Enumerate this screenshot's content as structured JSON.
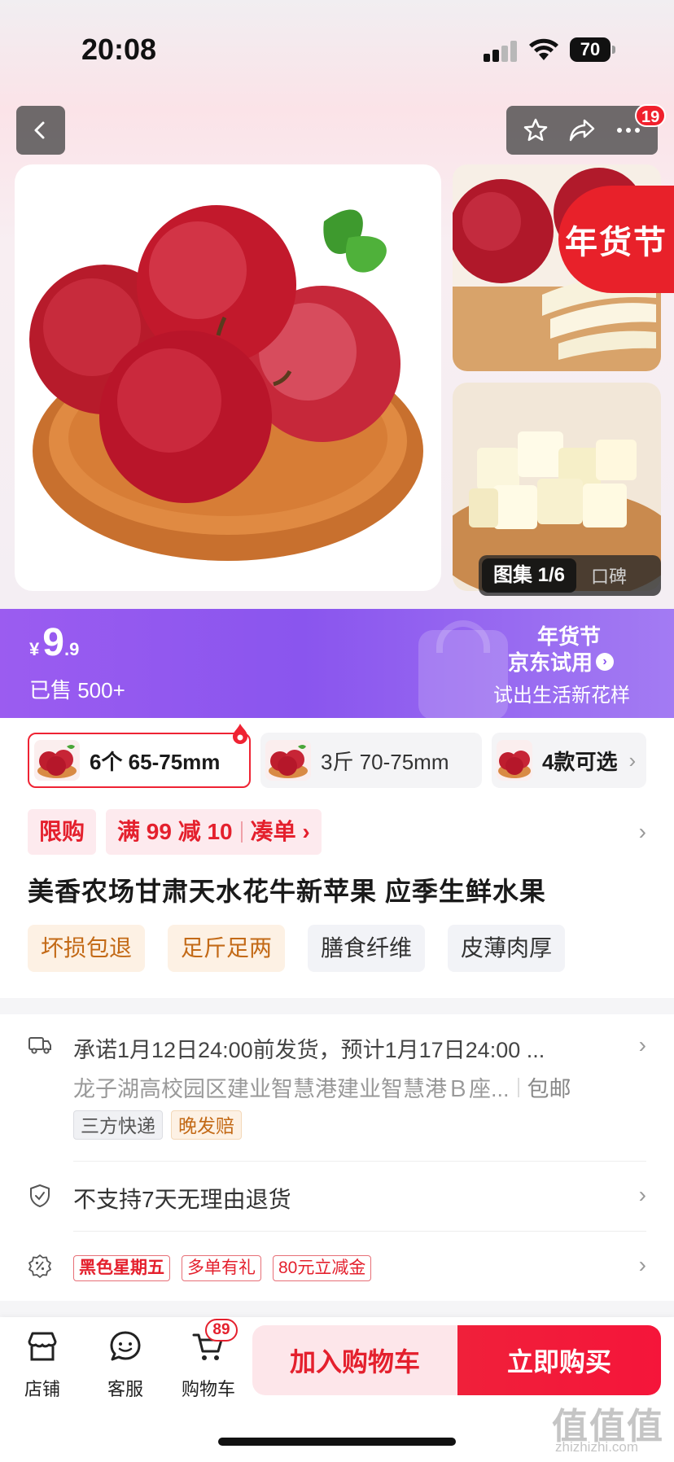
{
  "status_bar": {
    "time": "20:08",
    "battery": "70"
  },
  "header": {
    "notification_count": "19"
  },
  "gallery": {
    "badge_text": "年货节",
    "tab_album": "图集 1/6",
    "tab_reviews": "口碑"
  },
  "price": {
    "currency": "¥",
    "integer": "9",
    "decimal": ".9",
    "sold": "已售 500+"
  },
  "promo": {
    "logo": "年货节",
    "title": "京东试用",
    "subtitle": "试出生活新花样"
  },
  "variants": [
    {
      "label": "6个 65-75mm",
      "selected": true
    },
    {
      "label": "3斤 70-75mm",
      "selected": false
    },
    {
      "label": "4款可选",
      "selected": false
    }
  ],
  "deals": {
    "limit": "限购",
    "discount": "满 99 减 10",
    "combine": "凑单 ›"
  },
  "product": {
    "title": "美香农场甘肃天水花牛新苹果   应季生鲜水果",
    "feature_tags": [
      "坏损包退",
      "足斤足两",
      "膳食纤维",
      "皮薄肉厚"
    ]
  },
  "shipping": {
    "promise": "承诺1月12日24:00前发货，预计1月17日24:00 ...",
    "address": "龙子湖高校园区建业智慧港建业智慧港Ｂ座...",
    "free_shipping": "包邮",
    "tags": [
      "三方快递",
      "晚发赔"
    ]
  },
  "returns": {
    "text": "不支持7天无理由退货"
  },
  "promotions": {
    "tags": [
      "黑色星期五",
      "多单有礼",
      "80元立减金"
    ]
  },
  "bottom_bar": {
    "store": "店铺",
    "service": "客服",
    "cart": "购物车",
    "cart_count": "89",
    "add_to_cart": "加入购物车",
    "buy_now": "立即购买"
  },
  "watermark": {
    "main": "值值值",
    "sub": "zhizhizhi.com"
  },
  "colors": {
    "accent": "#e4202d",
    "promo_purple": "#8a55ee"
  }
}
